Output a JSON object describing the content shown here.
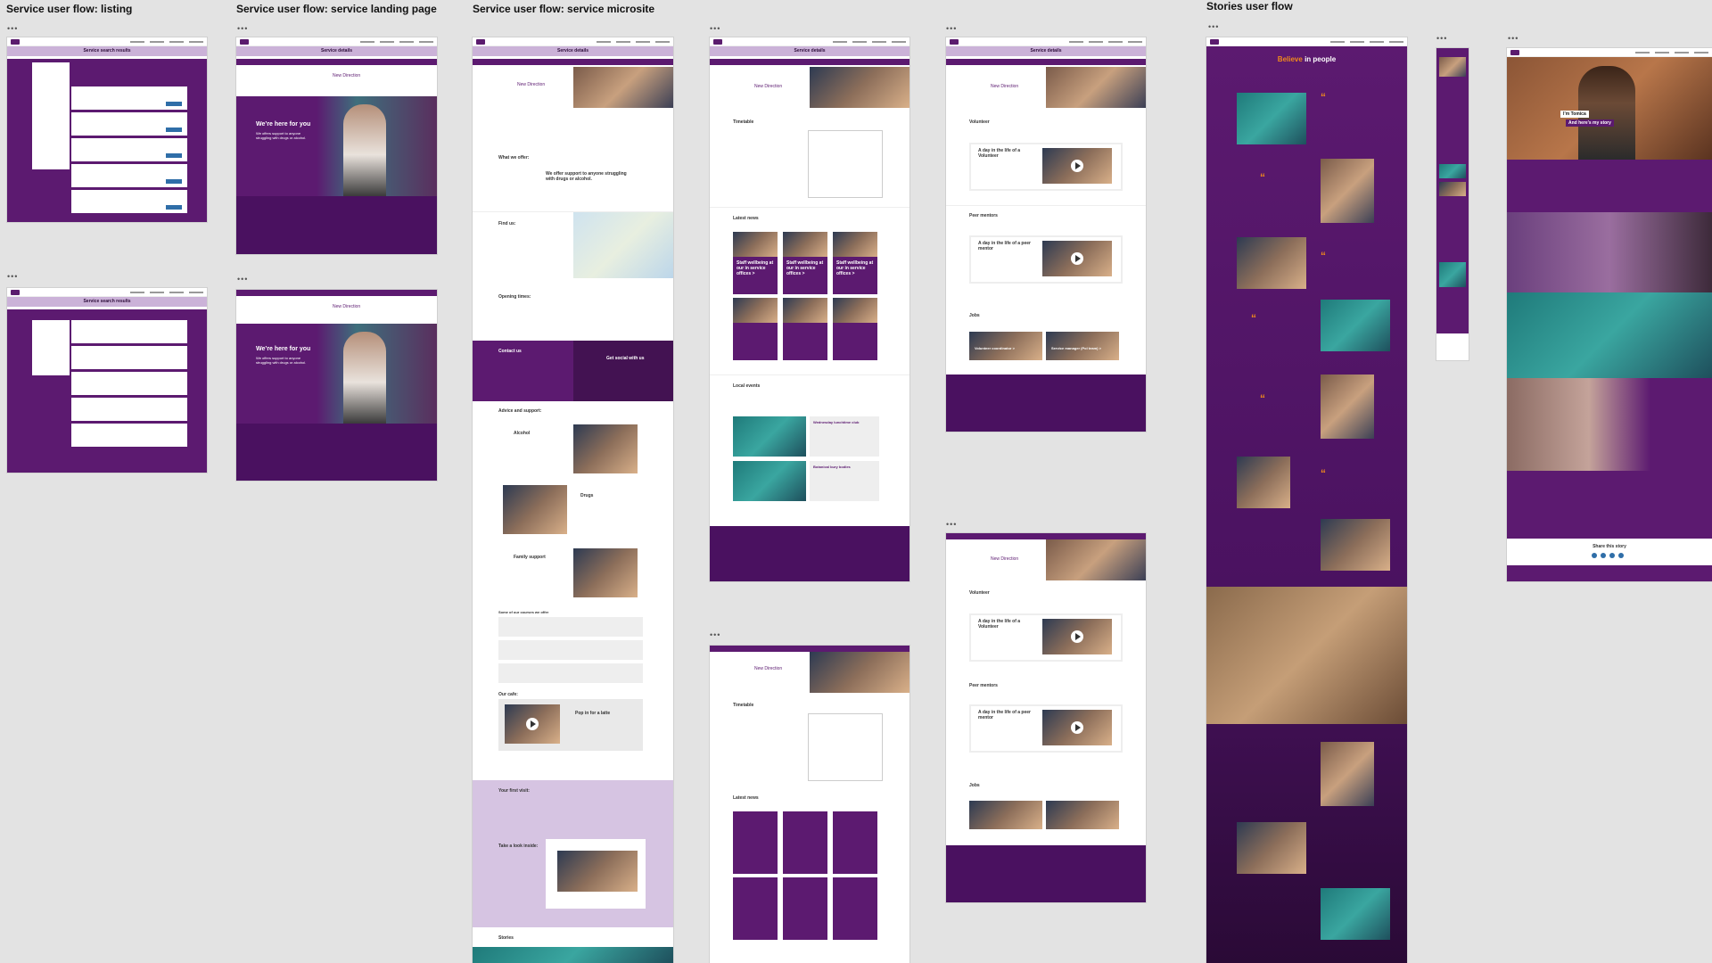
{
  "sections": {
    "listing": "Service user flow: listing",
    "landing": "Service user flow: service landing page",
    "microsite": "Service user flow: service microsite",
    "stories": "Stories user flow"
  },
  "dots": "•••",
  "listing_board": {
    "header": "Service search results"
  },
  "landing_board": {
    "header": "Service details",
    "hero_title": "We’re here for you",
    "hero_sub": "We offers support to anyone struggling with drugs or alcohol.",
    "brand": "New Direction"
  },
  "microsite_board": {
    "header": "Service details",
    "brand": "New Direction",
    "what_we_offer": "What we offer:",
    "offer_text": "We offer support to anyone struggling with drugs or alcohol.",
    "find_us": "Find us:",
    "opening_times": "Opening times:",
    "contact_us": "Contact us",
    "get_social": "Get social with us",
    "advice": "Advice and support:",
    "alcohol": "Alcohol",
    "drugs": "Drugs",
    "family": "Family support",
    "courses": "Some of our courses we offer",
    "cafe": "Our cafe:",
    "latte": "Pop in for a latte",
    "first_visit": "Your first visit:",
    "look_inside": "Take a look inside:",
    "stories": "Stories"
  },
  "timetable_board": {
    "header": "Service details",
    "brand": "New Direction",
    "timetable": "Timetable",
    "latest_news": "Latest news",
    "news_item": "Staff wellbeing at our in service offices >",
    "local_events": "Local events",
    "event1": "Wednesday lunchtime club",
    "event2": "Botanical bury bodies"
  },
  "volunteer_board": {
    "header": "Service details",
    "brand": "New Direction",
    "volunteer": "Volunteer",
    "day_volunteer": "A day in the life of a Volunteer",
    "peer_mentors": "Peer mentors",
    "day_peer": "A day in the life of a peer mentor",
    "jobs": "Jobs",
    "job1": "Volunteer coordinator >",
    "job2": "Service manager (Pol team) >"
  },
  "stories_board": {
    "title_a": "Believe",
    "title_b": "in people",
    "tomica": "I’m Tomica",
    "tomica_sub": "And here’s my story",
    "share": "Share this story"
  }
}
